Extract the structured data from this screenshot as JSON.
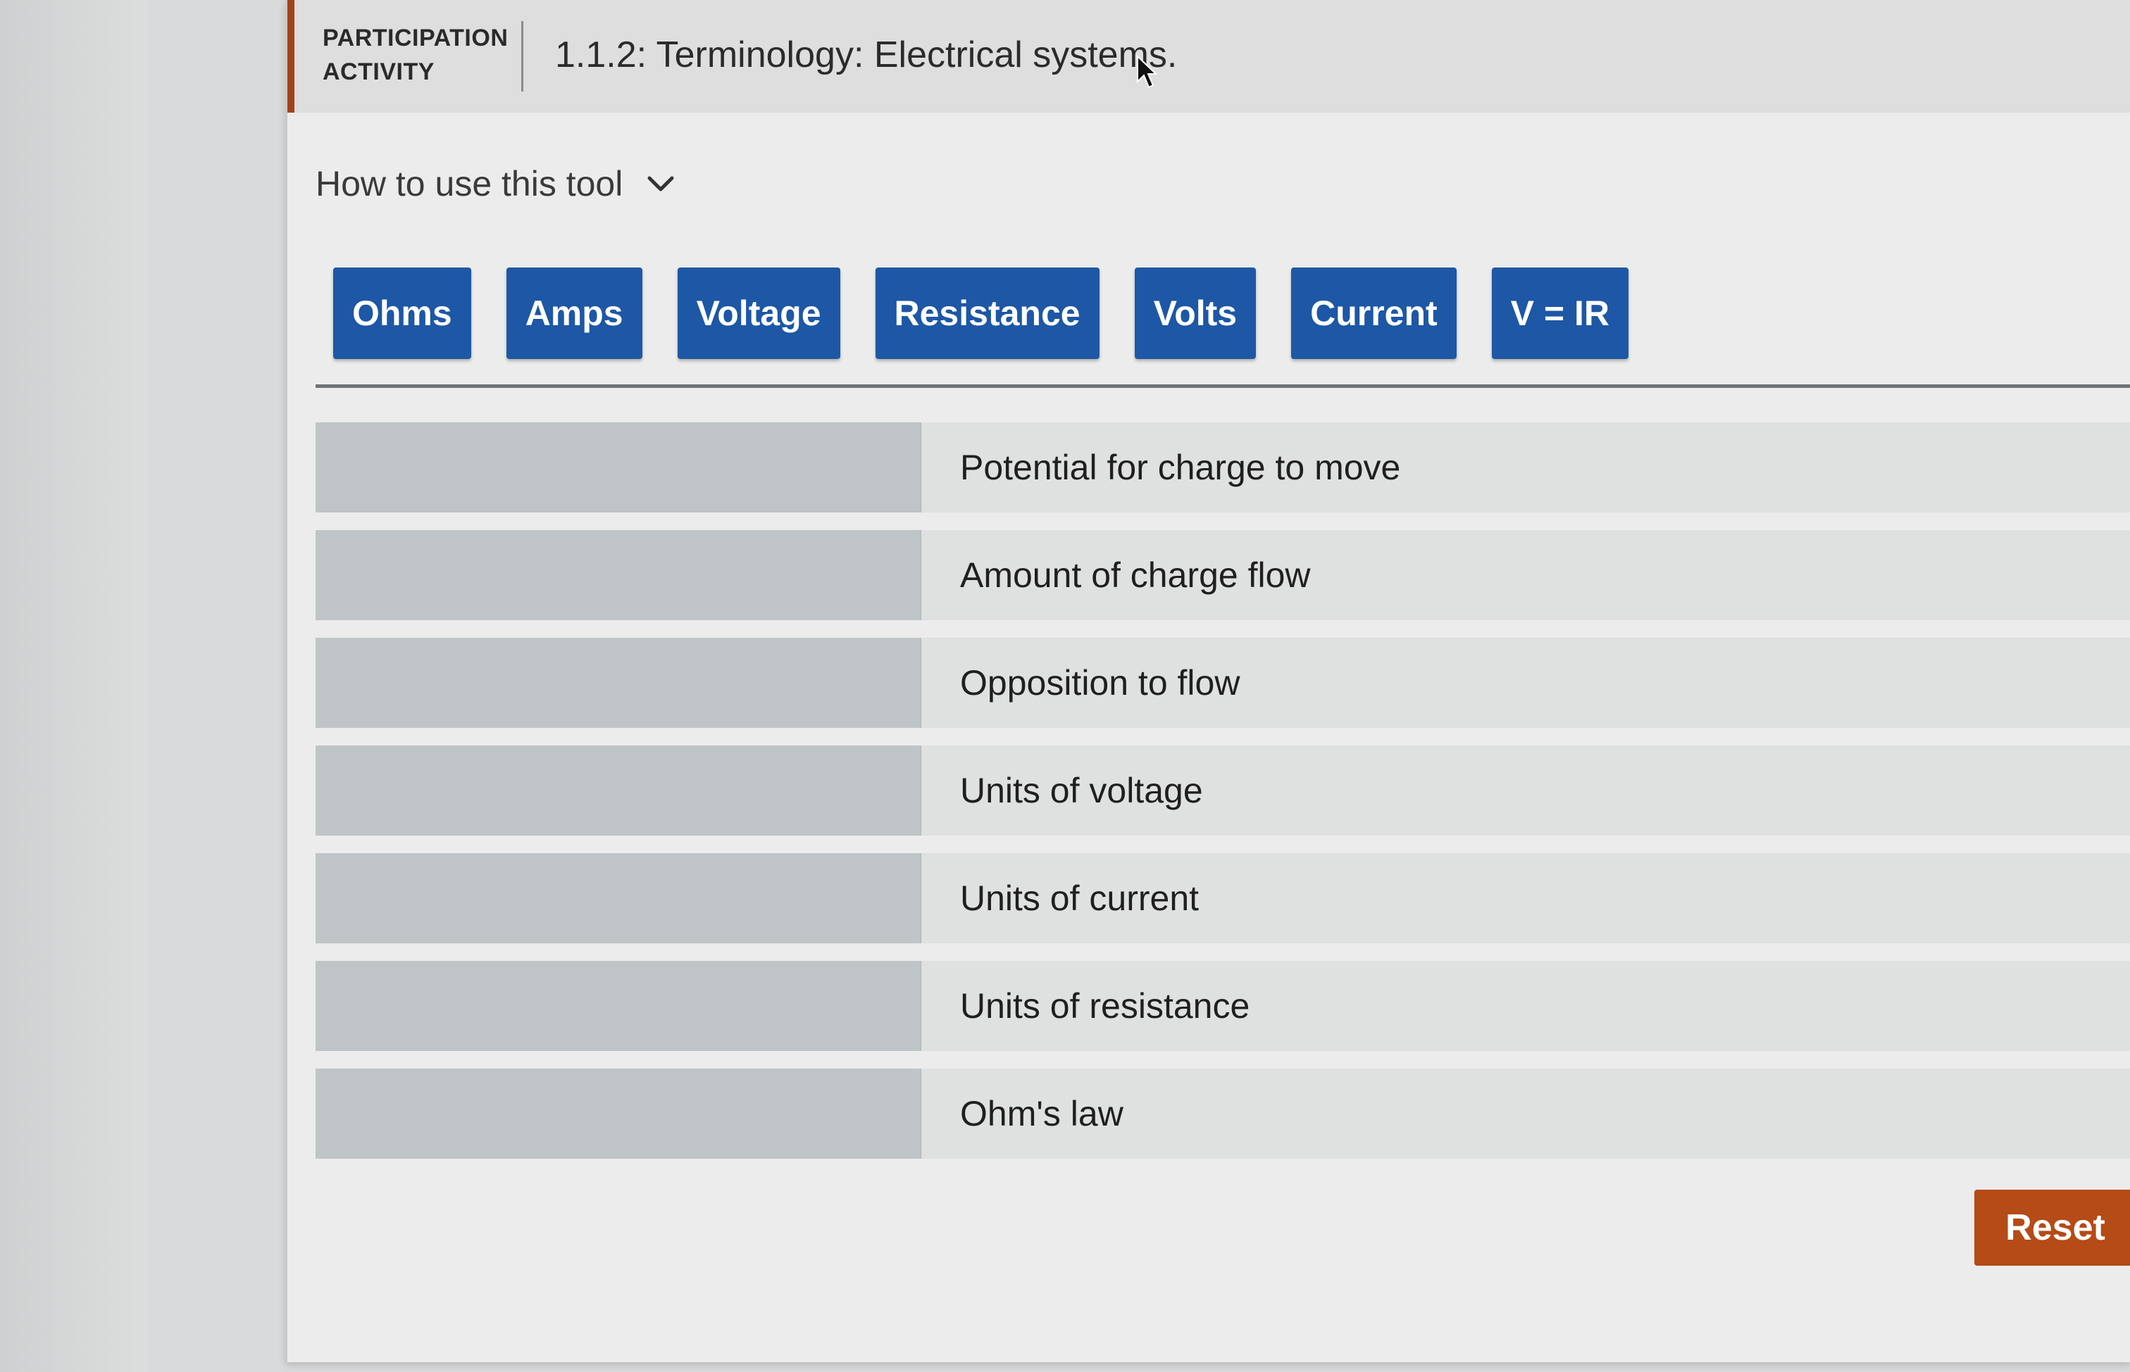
{
  "header": {
    "activity_type_line1": "PARTICIPATION",
    "activity_type_line2": "ACTIVITY",
    "title": "1.1.2: Terminology: Electrical systems."
  },
  "how_to": {
    "label": "How to use this tool",
    "icon": "chevron-down-icon"
  },
  "term_bank": {
    "terms": [
      "Ohms",
      "Amps",
      "Voltage",
      "Resistance",
      "Volts",
      "Current",
      "V = IR"
    ]
  },
  "match_rows": [
    {
      "definition": "Potential for charge to move",
      "answer": ""
    },
    {
      "definition": "Amount of charge flow",
      "answer": ""
    },
    {
      "definition": "Opposition to flow",
      "answer": ""
    },
    {
      "definition": "Units of voltage",
      "answer": ""
    },
    {
      "definition": "Units of current",
      "answer": ""
    },
    {
      "definition": "Units of resistance",
      "answer": ""
    },
    {
      "definition": "Ohm's law",
      "answer": ""
    }
  ],
  "actions": {
    "reset_label": "Reset"
  },
  "colors": {
    "term_button": "#1d57a5",
    "reset_button": "#b54b16",
    "accent_bar": "#a0431a",
    "drop_zone": "#bfc4c6"
  }
}
